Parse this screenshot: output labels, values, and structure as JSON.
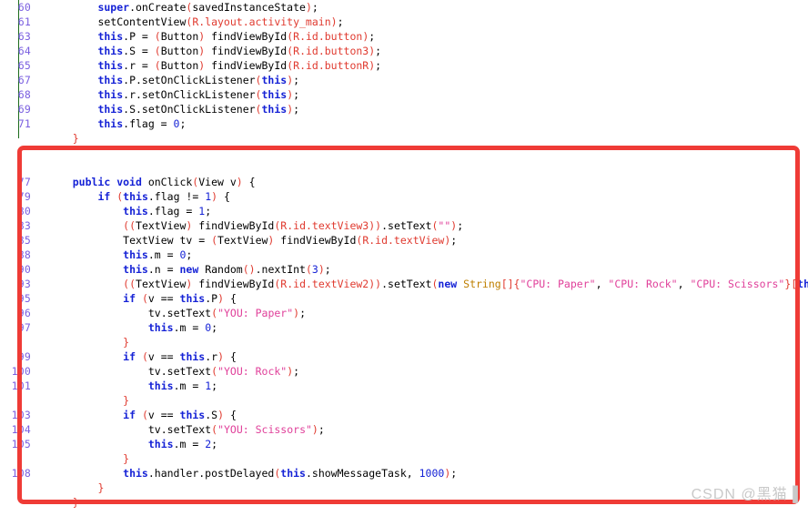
{
  "document": {
    "kind": "code-editor-screenshot",
    "language": "Java",
    "watermark": "CSDN @黑猫▐"
  },
  "colors": {
    "keyword": "#1522d6",
    "string": "#e0409a",
    "paren": "#e03a2f",
    "member": "#c6007f",
    "classname": "#bf7f00",
    "gutter": "#7a5fe0",
    "annotation_box": "#ef3b36",
    "change_bar": "#1d6b1d",
    "background": "#ffffff",
    "watermark": "#c9c9c9"
  },
  "annotation": {
    "shape": "rectangle",
    "color": "#ef3b36",
    "label": "highlighted-onclick-method"
  },
  "code": {
    "lines": [
      {
        "number": "60",
        "indent": 8,
        "tokens": [
          {
            "t": "super",
            "c": "kw"
          },
          {
            "t": ".",
            "c": "pln"
          },
          {
            "t": "onCreate",
            "c": "pln"
          },
          {
            "t": "(",
            "c": "par"
          },
          {
            "t": "savedInstanceState",
            "c": "pln"
          },
          {
            "t": ")",
            "c": "par"
          },
          {
            "t": ";",
            "c": "pln"
          }
        ]
      },
      {
        "number": "61",
        "indent": 8,
        "tokens": [
          {
            "t": "setContentView",
            "c": "pln"
          },
          {
            "t": "(",
            "c": "par"
          },
          {
            "t": "R.layout.activity_main",
            "c": "par"
          },
          {
            "t": ")",
            "c": "par"
          },
          {
            "t": ";",
            "c": "pln"
          }
        ]
      },
      {
        "number": "63",
        "indent": 8,
        "tokens": [
          {
            "t": "this",
            "c": "kw"
          },
          {
            "t": ".P = ",
            "c": "pln"
          },
          {
            "t": "(",
            "c": "par"
          },
          {
            "t": "Button",
            "c": "pln"
          },
          {
            "t": ")",
            "c": "par"
          },
          {
            "t": " findViewById",
            "c": "pln"
          },
          {
            "t": "(",
            "c": "par"
          },
          {
            "t": "R.id.button",
            "c": "par"
          },
          {
            "t": ")",
            "c": "par"
          },
          {
            "t": ";",
            "c": "pln"
          }
        ]
      },
      {
        "number": "64",
        "indent": 8,
        "tokens": [
          {
            "t": "this",
            "c": "kw"
          },
          {
            "t": ".S = ",
            "c": "pln"
          },
          {
            "t": "(",
            "c": "par"
          },
          {
            "t": "Button",
            "c": "pln"
          },
          {
            "t": ")",
            "c": "par"
          },
          {
            "t": " findViewById",
            "c": "pln"
          },
          {
            "t": "(",
            "c": "par"
          },
          {
            "t": "R.id.button3",
            "c": "par"
          },
          {
            "t": ")",
            "c": "par"
          },
          {
            "t": ";",
            "c": "pln"
          }
        ]
      },
      {
        "number": "65",
        "indent": 8,
        "tokens": [
          {
            "t": "this",
            "c": "kw"
          },
          {
            "t": ".r = ",
            "c": "pln"
          },
          {
            "t": "(",
            "c": "par"
          },
          {
            "t": "Button",
            "c": "pln"
          },
          {
            "t": ")",
            "c": "par"
          },
          {
            "t": " findViewById",
            "c": "pln"
          },
          {
            "t": "(",
            "c": "par"
          },
          {
            "t": "R.id.buttonR",
            "c": "par"
          },
          {
            "t": ")",
            "c": "par"
          },
          {
            "t": ";",
            "c": "pln"
          }
        ]
      },
      {
        "number": "67",
        "indent": 8,
        "tokens": [
          {
            "t": "this",
            "c": "kw"
          },
          {
            "t": ".P.setOnClickListener",
            "c": "pln"
          },
          {
            "t": "(",
            "c": "par"
          },
          {
            "t": "this",
            "c": "kw"
          },
          {
            "t": ")",
            "c": "par"
          },
          {
            "t": ";",
            "c": "pln"
          }
        ]
      },
      {
        "number": "68",
        "indent": 8,
        "tokens": [
          {
            "t": "this",
            "c": "kw"
          },
          {
            "t": ".r.setOnClickListener",
            "c": "pln"
          },
          {
            "t": "(",
            "c": "par"
          },
          {
            "t": "this",
            "c": "kw"
          },
          {
            "t": ")",
            "c": "par"
          },
          {
            "t": ";",
            "c": "pln"
          }
        ]
      },
      {
        "number": "69",
        "indent": 8,
        "tokens": [
          {
            "t": "this",
            "c": "kw"
          },
          {
            "t": ".S.setOnClickListener",
            "c": "pln"
          },
          {
            "t": "(",
            "c": "par"
          },
          {
            "t": "this",
            "c": "kw"
          },
          {
            "t": ")",
            "c": "par"
          },
          {
            "t": ";",
            "c": "pln"
          }
        ]
      },
      {
        "number": "71",
        "indent": 8,
        "tokens": [
          {
            "t": "this",
            "c": "kw"
          },
          {
            "t": ".flag = ",
            "c": "pln"
          },
          {
            "t": "0",
            "c": "num"
          },
          {
            "t": ";",
            "c": "pln"
          }
        ]
      },
      {
        "number": "",
        "indent": 4,
        "tokens": [
          {
            "t": "}",
            "c": "par"
          }
        ]
      },
      {
        "number": "",
        "indent": 0,
        "tokens": []
      },
      {
        "number": "",
        "indent": 0,
        "tokens": []
      },
      {
        "number": "77",
        "indent": 4,
        "tokens": [
          {
            "t": "public",
            "c": "kw"
          },
          {
            "t": " ",
            "c": "pln"
          },
          {
            "t": "void",
            "c": "kw"
          },
          {
            "t": " onClick",
            "c": "pln"
          },
          {
            "t": "(",
            "c": "par"
          },
          {
            "t": "View v",
            "c": "pln"
          },
          {
            "t": ")",
            "c": "par"
          },
          {
            "t": " {",
            "c": "pln"
          }
        ]
      },
      {
        "number": "79",
        "indent": 8,
        "tokens": [
          {
            "t": "if",
            "c": "kw"
          },
          {
            "t": " ",
            "c": "pln"
          },
          {
            "t": "(",
            "c": "par"
          },
          {
            "t": "this",
            "c": "kw"
          },
          {
            "t": ".flag != ",
            "c": "pln"
          },
          {
            "t": "1",
            "c": "num"
          },
          {
            "t": ")",
            "c": "par"
          },
          {
            "t": " {",
            "c": "pln"
          }
        ]
      },
      {
        "number": "80",
        "indent": 12,
        "tokens": [
          {
            "t": "this",
            "c": "kw"
          },
          {
            "t": ".flag = ",
            "c": "pln"
          },
          {
            "t": "1",
            "c": "num"
          },
          {
            "t": ";",
            "c": "pln"
          }
        ]
      },
      {
        "number": "83",
        "indent": 12,
        "tokens": [
          {
            "t": "((",
            "c": "par"
          },
          {
            "t": "TextView",
            "c": "pln"
          },
          {
            "t": ")",
            "c": "par"
          },
          {
            "t": " findViewById",
            "c": "pln"
          },
          {
            "t": "(",
            "c": "par"
          },
          {
            "t": "R.id.textView3",
            "c": "par"
          },
          {
            "t": "))",
            "c": "par"
          },
          {
            "t": ".setText",
            "c": "pln"
          },
          {
            "t": "(",
            "c": "par"
          },
          {
            "t": "\"\"",
            "c": "str"
          },
          {
            "t": ")",
            "c": "par"
          },
          {
            "t": ";",
            "c": "pln"
          }
        ]
      },
      {
        "number": "85",
        "indent": 12,
        "tokens": [
          {
            "t": "TextView tv = ",
            "c": "pln"
          },
          {
            "t": "(",
            "c": "par"
          },
          {
            "t": "TextView",
            "c": "pln"
          },
          {
            "t": ")",
            "c": "par"
          },
          {
            "t": " findViewById",
            "c": "pln"
          },
          {
            "t": "(",
            "c": "par"
          },
          {
            "t": "R.id.textView",
            "c": "par"
          },
          {
            "t": ")",
            "c": "par"
          },
          {
            "t": ";",
            "c": "pln"
          }
        ]
      },
      {
        "number": "88",
        "indent": 12,
        "tokens": [
          {
            "t": "this",
            "c": "kw"
          },
          {
            "t": ".m = ",
            "c": "pln"
          },
          {
            "t": "0",
            "c": "num"
          },
          {
            "t": ";",
            "c": "pln"
          }
        ]
      },
      {
        "number": "90",
        "indent": 12,
        "tokens": [
          {
            "t": "this",
            "c": "kw"
          },
          {
            "t": ".n = ",
            "c": "pln"
          },
          {
            "t": "new",
            "c": "kw"
          },
          {
            "t": " Random",
            "c": "pln"
          },
          {
            "t": "()",
            "c": "par"
          },
          {
            "t": ".nextInt",
            "c": "pln"
          },
          {
            "t": "(",
            "c": "par"
          },
          {
            "t": "3",
            "c": "num"
          },
          {
            "t": ")",
            "c": "par"
          },
          {
            "t": ";",
            "c": "pln"
          }
        ]
      },
      {
        "number": "93",
        "indent": 12,
        "tokens": [
          {
            "t": "((",
            "c": "par"
          },
          {
            "t": "TextView",
            "c": "pln"
          },
          {
            "t": ")",
            "c": "par"
          },
          {
            "t": " findViewById",
            "c": "pln"
          },
          {
            "t": "(",
            "c": "par"
          },
          {
            "t": "R.id.textView2",
            "c": "par"
          },
          {
            "t": "))",
            "c": "par"
          },
          {
            "t": ".setText",
            "c": "pln"
          },
          {
            "t": "(",
            "c": "par"
          },
          {
            "t": "new",
            "c": "kw"
          },
          {
            "t": " ",
            "c": "pln"
          },
          {
            "t": "String",
            "c": "cls"
          },
          {
            "t": "[]{",
            "c": "par"
          },
          {
            "t": "\"CPU: Paper\"",
            "c": "str"
          },
          {
            "t": ", ",
            "c": "pln"
          },
          {
            "t": "\"CPU: Rock\"",
            "c": "str"
          },
          {
            "t": ", ",
            "c": "pln"
          },
          {
            "t": "\"CPU: Scissors\"",
            "c": "str"
          },
          {
            "t": "}[",
            "c": "par"
          },
          {
            "t": "thi",
            "c": "kw"
          }
        ]
      },
      {
        "number": "95",
        "indent": 12,
        "tokens": [
          {
            "t": "if",
            "c": "kw"
          },
          {
            "t": " ",
            "c": "pln"
          },
          {
            "t": "(",
            "c": "par"
          },
          {
            "t": "v == ",
            "c": "pln"
          },
          {
            "t": "this",
            "c": "kw"
          },
          {
            "t": ".P",
            "c": "pln"
          },
          {
            "t": ")",
            "c": "par"
          },
          {
            "t": " {",
            "c": "pln"
          }
        ]
      },
      {
        "number": "96",
        "indent": 16,
        "tokens": [
          {
            "t": "tv.setText",
            "c": "pln"
          },
          {
            "t": "(",
            "c": "par"
          },
          {
            "t": "\"YOU: Paper\"",
            "c": "str"
          },
          {
            "t": ")",
            "c": "par"
          },
          {
            "t": ";",
            "c": "pln"
          }
        ]
      },
      {
        "number": "97",
        "indent": 16,
        "tokens": [
          {
            "t": "this",
            "c": "kw"
          },
          {
            "t": ".m = ",
            "c": "pln"
          },
          {
            "t": "0",
            "c": "num"
          },
          {
            "t": ";",
            "c": "pln"
          }
        ]
      },
      {
        "number": "",
        "indent": 12,
        "tokens": [
          {
            "t": "}",
            "c": "par"
          }
        ]
      },
      {
        "number": "99",
        "indent": 12,
        "tokens": [
          {
            "t": "if",
            "c": "kw"
          },
          {
            "t": " ",
            "c": "pln"
          },
          {
            "t": "(",
            "c": "par"
          },
          {
            "t": "v == ",
            "c": "pln"
          },
          {
            "t": "this",
            "c": "kw"
          },
          {
            "t": ".r",
            "c": "pln"
          },
          {
            "t": ")",
            "c": "par"
          },
          {
            "t": " {",
            "c": "pln"
          }
        ]
      },
      {
        "number": "100",
        "indent": 16,
        "tokens": [
          {
            "t": "tv.setText",
            "c": "pln"
          },
          {
            "t": "(",
            "c": "par"
          },
          {
            "t": "\"YOU: Rock\"",
            "c": "str"
          },
          {
            "t": ")",
            "c": "par"
          },
          {
            "t": ";",
            "c": "pln"
          }
        ]
      },
      {
        "number": "101",
        "indent": 16,
        "tokens": [
          {
            "t": "this",
            "c": "kw"
          },
          {
            "t": ".m = ",
            "c": "pln"
          },
          {
            "t": "1",
            "c": "num"
          },
          {
            "t": ";",
            "c": "pln"
          }
        ]
      },
      {
        "number": "",
        "indent": 12,
        "tokens": [
          {
            "t": "}",
            "c": "par"
          }
        ]
      },
      {
        "number": "103",
        "indent": 12,
        "tokens": [
          {
            "t": "if",
            "c": "kw"
          },
          {
            "t": " ",
            "c": "pln"
          },
          {
            "t": "(",
            "c": "par"
          },
          {
            "t": "v == ",
            "c": "pln"
          },
          {
            "t": "this",
            "c": "kw"
          },
          {
            "t": ".S",
            "c": "pln"
          },
          {
            "t": ")",
            "c": "par"
          },
          {
            "t": " {",
            "c": "pln"
          }
        ]
      },
      {
        "number": "104",
        "indent": 16,
        "tokens": [
          {
            "t": "tv.setText",
            "c": "pln"
          },
          {
            "t": "(",
            "c": "par"
          },
          {
            "t": "\"YOU: Scissors\"",
            "c": "str"
          },
          {
            "t": ")",
            "c": "par"
          },
          {
            "t": ";",
            "c": "pln"
          }
        ]
      },
      {
        "number": "105",
        "indent": 16,
        "tokens": [
          {
            "t": "this",
            "c": "kw"
          },
          {
            "t": ".m = ",
            "c": "pln"
          },
          {
            "t": "2",
            "c": "num"
          },
          {
            "t": ";",
            "c": "pln"
          }
        ]
      },
      {
        "number": "",
        "indent": 12,
        "tokens": [
          {
            "t": "}",
            "c": "par"
          }
        ]
      },
      {
        "number": "108",
        "indent": 12,
        "tokens": [
          {
            "t": "this",
            "c": "kw"
          },
          {
            "t": ".handler.postDelayed",
            "c": "pln"
          },
          {
            "t": "(",
            "c": "par"
          },
          {
            "t": "this",
            "c": "kw"
          },
          {
            "t": ".showMessageTask, ",
            "c": "pln"
          },
          {
            "t": "1000",
            "c": "num"
          },
          {
            "t": ")",
            "c": "par"
          },
          {
            "t": ";",
            "c": "pln"
          }
        ]
      },
      {
        "number": "",
        "indent": 8,
        "tokens": [
          {
            "t": "}",
            "c": "par"
          }
        ]
      },
      {
        "number": "",
        "indent": 4,
        "tokens": [
          {
            "t": "}",
            "c": "par"
          }
        ]
      }
    ]
  }
}
